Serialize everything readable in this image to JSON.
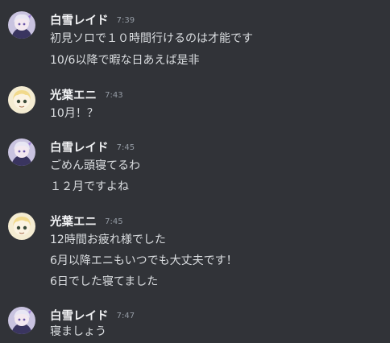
{
  "messages": [
    {
      "author": "白雪レイド",
      "time": "7:39",
      "avatar": "white-haired-purple-avatar",
      "lines": [
        "初見ソロで１０時間行けるのは才能です",
        "10/6以降で暇な日あえば是非"
      ]
    },
    {
      "author": "光葉エニ",
      "time": "7:43",
      "avatar": "blonde-cream-avatar",
      "lines": [
        "10月！？"
      ]
    },
    {
      "author": "白雪レイド",
      "time": "7:45",
      "avatar": "white-haired-purple-avatar",
      "lines": [
        "ごめん頭寝てるわ",
        "１２月ですよね"
      ]
    },
    {
      "author": "光葉エニ",
      "time": "7:45",
      "avatar": "blonde-cream-avatar",
      "lines": [
        "12時間お疲れ様でした",
        "6月以降エニもいつでも大丈夫です！",
        "6日でした寝てました"
      ]
    },
    {
      "author": "白雪レイド",
      "time": "7:47",
      "avatar": "white-haired-purple-avatar",
      "lines": [
        "寝ましょう"
      ]
    }
  ]
}
